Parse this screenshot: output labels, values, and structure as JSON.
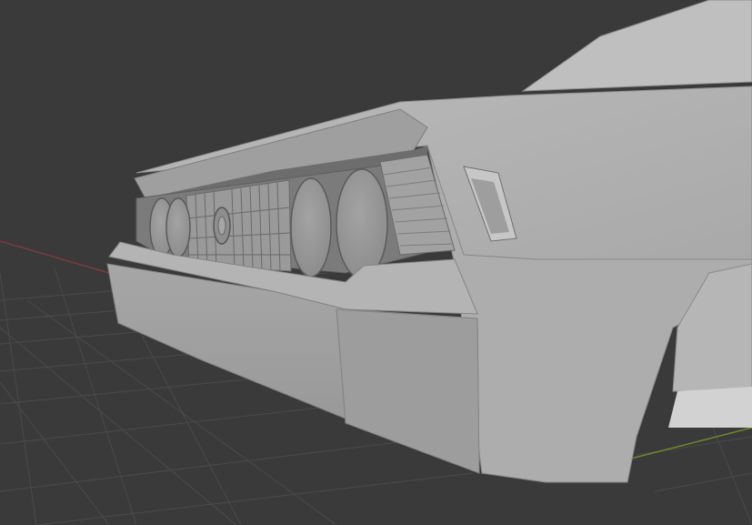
{
  "app": {
    "view": "3D Viewport",
    "shading_mode": "solid",
    "background_color": "#3a3a3a",
    "grid_color": "#4a4a4a",
    "x_axis_color": "#7a3a3a",
    "y_axis_color": "#6c8a2a"
  },
  "scene": {
    "object": "car-front-model",
    "material_color": "#a8a8a8"
  }
}
